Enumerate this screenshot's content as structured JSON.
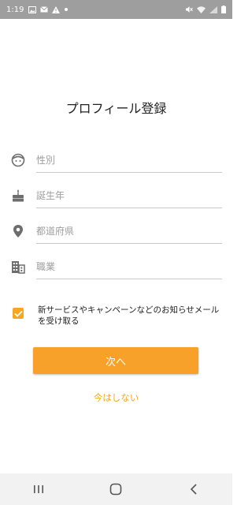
{
  "status_bar": {
    "time": "1:19",
    "left_icons": [
      "image-icon",
      "mail-icon",
      "warning-icon",
      "dot-icon"
    ],
    "right_icons": [
      "mute-icon",
      "wifi-icon",
      "signal-icon",
      "battery-icon"
    ]
  },
  "page": {
    "title": "プロフィール登録"
  },
  "form": {
    "fields": [
      {
        "icon": "face-icon",
        "value": "",
        "placeholder": "性別"
      },
      {
        "icon": "cake-icon",
        "value": "",
        "placeholder": "誕生年"
      },
      {
        "icon": "location-pin-icon",
        "value": "",
        "placeholder": "都道府県"
      },
      {
        "icon": "building-icon",
        "value": "",
        "placeholder": "職業"
      }
    ],
    "newsletter": {
      "checked": true,
      "label": "新サービスやキャンペーンなどのお知らせメールを受け取る"
    },
    "next_label": "次へ",
    "skip_label": "今はしない"
  },
  "navigation_bar": {
    "buttons": [
      "recent-apps-icon",
      "home-icon",
      "back-icon"
    ]
  },
  "colors": {
    "accent": "#f7a12b",
    "status_bar": "#9e9e9e",
    "icon_gray": "#6d6d6d"
  }
}
